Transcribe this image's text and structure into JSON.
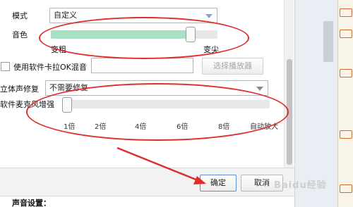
{
  "mode": {
    "label": "模式",
    "value": "自定义"
  },
  "timbre": {
    "label": "音色",
    "level": 0.84,
    "min_label": "变粗",
    "max_label": "变尖"
  },
  "karaoke": {
    "label": "使用软件卡拉OK混音",
    "input_value": "",
    "button_label": "选择播放器",
    "checked": false
  },
  "stereo": {
    "label": "立体声修复",
    "value": "不需要修复"
  },
  "mic": {
    "label": "软件麦克风增强",
    "level": 0.0,
    "ticks": [
      "1倍",
      "2倍",
      "4倍",
      "6倍",
      "8倍",
      "自动放大"
    ]
  },
  "footer": {
    "ok_label": "确定",
    "cancel_label": "取消"
  },
  "bottom": {
    "section_label": "声音设置："
  },
  "watermark": "Baidu经验",
  "colors": {
    "annotation": "#e22b2b",
    "slider_fill": "#a8e0c4"
  }
}
